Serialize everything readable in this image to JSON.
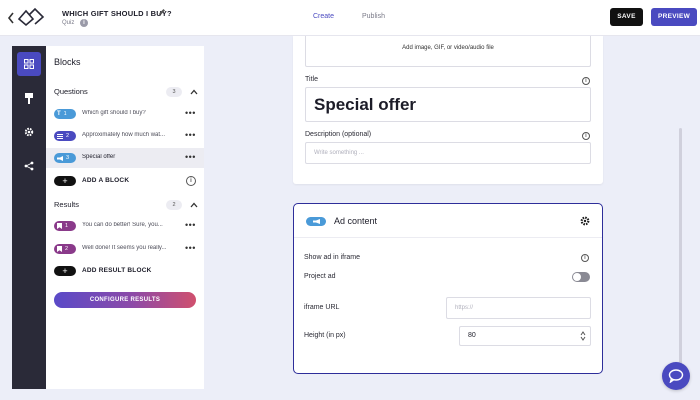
{
  "header": {
    "quiz_title": "WHICH GIFT SHOULD I BUY?",
    "quiz_type": "Quiz",
    "info_glyph": "i",
    "tabs": [
      {
        "label": "Create",
        "active": true
      },
      {
        "label": "Publish",
        "active": false
      }
    ],
    "save_label": "SAVE",
    "preview_label": "PREVIEW"
  },
  "rail": {
    "items": [
      {
        "icon": "blocks-grid-icon",
        "active": true
      },
      {
        "icon": "paint-brush-icon",
        "active": false
      },
      {
        "icon": "settings-gear-icon",
        "active": false
      },
      {
        "icon": "share-icon",
        "active": false
      }
    ]
  },
  "panel": {
    "title": "Blocks",
    "questions": {
      "heading": "Questions",
      "count": "3",
      "items": [
        {
          "number": "1",
          "text": "Which gift should I buy?",
          "badge_color": "#4a9ad8",
          "icon": "text-icon",
          "selected": false
        },
        {
          "number": "2",
          "text": "Approximately how much wat...",
          "badge_color": "#4a4ac0",
          "icon": "list-icon",
          "selected": false
        },
        {
          "number": "3",
          "text": "Special offer",
          "badge_color": "#4a9ad8",
          "icon": "megaphone-icon",
          "selected": true
        }
      ],
      "add_label": "ADD A BLOCK"
    },
    "results": {
      "heading": "Results",
      "count": "2",
      "items": [
        {
          "number": "1",
          "text": "You can do better! Sure, you...",
          "badge_color": "#8a3a8a",
          "icon": "bookmark-icon"
        },
        {
          "number": "2",
          "text": "Well done! It seems you really...",
          "badge_color": "#8a3a8a",
          "icon": "bookmark-icon"
        }
      ],
      "add_label": "ADD RESULT BLOCK"
    },
    "menu_glyph": "•••",
    "add_glyph": "+",
    "configure_label": "CONFIGURE RESULTS"
  },
  "editor": {
    "media_label": "Add image, GIF, or video/audio file",
    "title_label": "Title",
    "title_value": "Special offer",
    "description_label": "Description (optional)",
    "description_placeholder": "Write something ..."
  },
  "ad_card": {
    "title": "Ad content",
    "show_in_iframe_label": "Show ad in iframe",
    "project_ad_label": "Project ad",
    "project_ad_enabled": false,
    "iframe_url_label": "iframe URL",
    "iframe_url_placeholder": "https://",
    "height_label": "Height (in px)",
    "height_value": "80"
  },
  "colors": {
    "accent": "#4a4ac0",
    "rail_bg": "#2a2a38",
    "page_bg": "#eceef8"
  }
}
